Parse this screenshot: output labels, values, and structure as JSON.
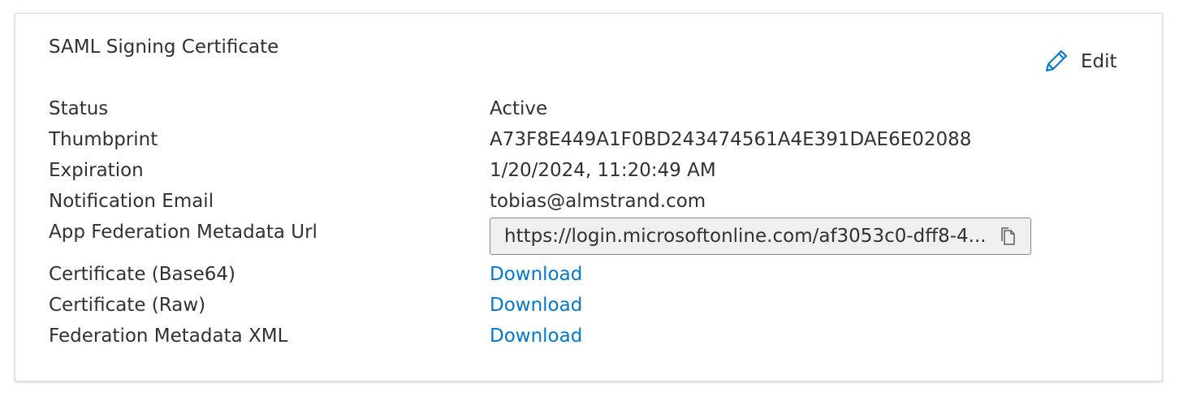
{
  "card": {
    "title": "SAML Signing Certificate",
    "edit_label": "Edit"
  },
  "icons": {
    "edit": "pencil-icon",
    "copy": "copy-icon"
  },
  "colors": {
    "link": "#0078d4",
    "text": "#323130",
    "field_bg": "#f0f0f0"
  },
  "rows": {
    "status": {
      "label": "Status",
      "value": "Active"
    },
    "thumbprint": {
      "label": "Thumbprint",
      "value": "A73F8E449A1F0BD243474561A4E391DAE6E02088"
    },
    "expiration": {
      "label": "Expiration",
      "value": "1/20/2024, 11:20:49 AM"
    },
    "notification_email": {
      "label": "Notification Email",
      "value": "tobias@almstrand.com"
    },
    "metadata_url": {
      "label": "App Federation Metadata Url",
      "value": "https://login.microsoftonline.com/af3053c0-dff8-4..."
    },
    "cert_base64": {
      "label": "Certificate (Base64)",
      "link": "Download"
    },
    "cert_raw": {
      "label": "Certificate (Raw)",
      "link": "Download"
    },
    "federation_xml": {
      "label": "Federation Metadata XML",
      "link": "Download"
    }
  }
}
